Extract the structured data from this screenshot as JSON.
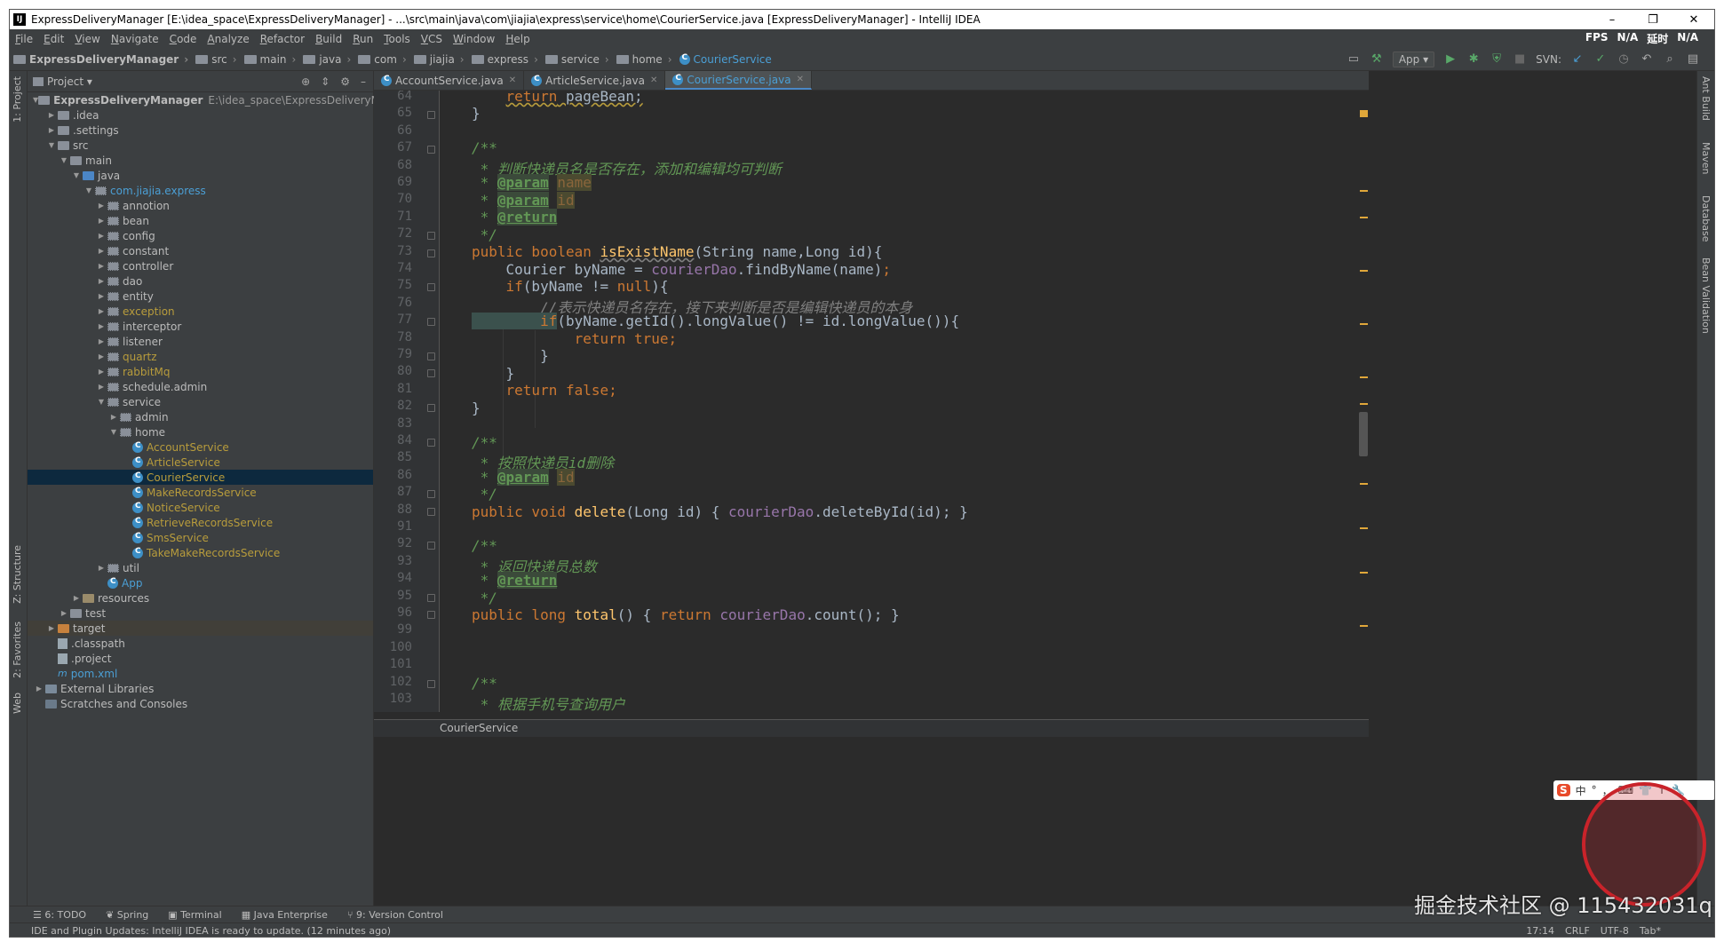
{
  "window": {
    "title": "ExpressDeliveryManager [E:\\idea_space\\ExpressDeliveryManager] - ...\\src\\main\\java\\com\\jiajia\\express\\service\\home\\CourierService.java [ExpressDeliveryManager] - IntelliJ IDEA",
    "app_icon": "IJ"
  },
  "menu": {
    "items": [
      "File",
      "Edit",
      "View",
      "Navigate",
      "Code",
      "Analyze",
      "Refactor",
      "Build",
      "Run",
      "Tools",
      "VCS",
      "Window",
      "Help"
    ],
    "right": [
      "FPS",
      "N/A",
      "延时",
      "N/A"
    ]
  },
  "breadcrumbs": [
    "ExpressDeliveryManager",
    "src",
    "main",
    "java",
    "com",
    "jiajia",
    "express",
    "service",
    "home",
    "CourierService"
  ],
  "toolbar": {
    "run_config": "App",
    "svn_label": "SVN:"
  },
  "left_tabs": {
    "project": "1: Project",
    "structure": "Z: Structure",
    "favorites": "2: Favorites",
    "web": "Web"
  },
  "right_tabs": {
    "ant": "Ant Build",
    "maven": "Maven",
    "database": "Database",
    "bean": "Bean Validation"
  },
  "project_panel": {
    "title": "Project",
    "tree": [
      {
        "label": "ExpressDeliveryManager",
        "extra": "E:\\idea_space\\ExpressDeliveryManager",
        "depth": 0,
        "arrow": "open",
        "icon": "module",
        "bold": true
      },
      {
        "label": ".idea",
        "depth": 1,
        "arrow": "closed",
        "icon": "folder"
      },
      {
        "label": ".settings",
        "depth": 1,
        "arrow": "closed",
        "icon": "folder"
      },
      {
        "label": "src",
        "depth": 1,
        "arrow": "open",
        "icon": "folder"
      },
      {
        "label": "main",
        "depth": 2,
        "arrow": "open",
        "icon": "folder"
      },
      {
        "label": "java",
        "depth": 3,
        "arrow": "open",
        "icon": "folder-blue"
      },
      {
        "label": "com.jiajia.express",
        "depth": 4,
        "arrow": "open",
        "icon": "package",
        "color": "blue"
      },
      {
        "label": "annotion",
        "depth": 5,
        "arrow": "closed",
        "icon": "package"
      },
      {
        "label": "bean",
        "depth": 5,
        "arrow": "closed",
        "icon": "package"
      },
      {
        "label": "config",
        "depth": 5,
        "arrow": "closed",
        "icon": "package"
      },
      {
        "label": "constant",
        "depth": 5,
        "arrow": "closed",
        "icon": "package"
      },
      {
        "label": "controller",
        "depth": 5,
        "arrow": "closed",
        "icon": "package"
      },
      {
        "label": "dao",
        "depth": 5,
        "arrow": "closed",
        "icon": "package"
      },
      {
        "label": "entity",
        "depth": 5,
        "arrow": "closed",
        "icon": "package"
      },
      {
        "label": "exception",
        "depth": 5,
        "arrow": "closed",
        "icon": "package",
        "color": "olive"
      },
      {
        "label": "interceptor",
        "depth": 5,
        "arrow": "closed",
        "icon": "package"
      },
      {
        "label": "listener",
        "depth": 5,
        "arrow": "closed",
        "icon": "package"
      },
      {
        "label": "quartz",
        "depth": 5,
        "arrow": "closed",
        "icon": "package",
        "color": "olive"
      },
      {
        "label": "rabbitMq",
        "depth": 5,
        "arrow": "closed",
        "icon": "package",
        "color": "olive"
      },
      {
        "label": "schedule.admin",
        "depth": 5,
        "arrow": "closed",
        "icon": "package"
      },
      {
        "label": "service",
        "depth": 5,
        "arrow": "open",
        "icon": "package"
      },
      {
        "label": "admin",
        "depth": 6,
        "arrow": "closed",
        "icon": "package"
      },
      {
        "label": "home",
        "depth": 6,
        "arrow": "open",
        "icon": "package"
      },
      {
        "label": "AccountService",
        "depth": 7,
        "icon": "class",
        "color": "olive"
      },
      {
        "label": "ArticleService",
        "depth": 7,
        "icon": "class",
        "color": "olive"
      },
      {
        "label": "CourierService",
        "depth": 7,
        "icon": "class",
        "color": "olive",
        "selected": true
      },
      {
        "label": "MakeRecordsService",
        "depth": 7,
        "icon": "class",
        "color": "olive"
      },
      {
        "label": "NoticeService",
        "depth": 7,
        "icon": "class",
        "color": "olive"
      },
      {
        "label": "RetrieveRecordsService",
        "depth": 7,
        "icon": "class",
        "color": "olive"
      },
      {
        "label": "SmsService",
        "depth": 7,
        "icon": "class",
        "color": "olive"
      },
      {
        "label": "TakeMakeRecordsService",
        "depth": 7,
        "icon": "class",
        "color": "olive"
      },
      {
        "label": "util",
        "depth": 5,
        "arrow": "closed",
        "icon": "package"
      },
      {
        "label": "App",
        "depth": 5,
        "icon": "class",
        "color": "blue"
      },
      {
        "label": "resources",
        "depth": 3,
        "arrow": "closed",
        "icon": "folder-res"
      },
      {
        "label": "test",
        "depth": 2,
        "arrow": "closed",
        "icon": "folder"
      },
      {
        "label": "target",
        "depth": 1,
        "arrow": "closed",
        "icon": "folder-orange",
        "highlight": true
      },
      {
        "label": ".classpath",
        "depth": 1,
        "icon": "file"
      },
      {
        "label": ".project",
        "depth": 1,
        "icon": "file"
      },
      {
        "label": "pom.xml",
        "depth": 1,
        "icon": "maven",
        "color": "blue"
      },
      {
        "label": "External Libraries",
        "depth": 0,
        "arrow": "closed",
        "icon": "libs"
      },
      {
        "label": "Scratches and Consoles",
        "depth": 0,
        "icon": "scratch"
      }
    ]
  },
  "editor": {
    "tabs": [
      {
        "label": "AccountService.java",
        "active": false
      },
      {
        "label": "ArticleService.java",
        "active": false
      },
      {
        "label": "CourierService.java",
        "active": true
      }
    ],
    "line_numbers": [
      "64",
      "65",
      "66",
      "67",
      "68",
      "69",
      "70",
      "71",
      "72",
      "73",
      "74",
      "75",
      "76",
      "77",
      "78",
      "79",
      "80",
      "81",
      "82",
      "83",
      "84",
      "85",
      "86",
      "87",
      "88",
      "91",
      "92",
      "93",
      "94",
      "95",
      "96",
      "99",
      "100",
      "101",
      "102",
      "103"
    ],
    "code_text": {
      "l64_return": "return",
      "l64_rest": " pageBean;",
      "l65": "}",
      "l67": "/**",
      "l68": " * 判断快递员名是否存在，添加和编辑均可判断",
      "l69_star": " * ",
      "l69_tag": "@param",
      "l69_name": "name",
      "l70_star": " * ",
      "l70_tag": "@param",
      "l70_name": "id",
      "l71_star": " * ",
      "l71_tag": "@return",
      "l72": " */",
      "l73_kw": "public boolean ",
      "l73_fn": "isExistName",
      "l73_rest": "(String name,Long id){",
      "l74_a": "    Courier byName = ",
      "l74_fld": "courierDao",
      "l74_b": ".findByName(name)",
      "l74_semi": ";",
      "l75_kw": "    if",
      "l75_rest": "(byName != ",
      "l75_null": "null",
      "l75_end": "){",
      "l76": "        //表示快递员名存在，接下来判断是否是编辑快递员的本身",
      "l77_kw": "        if",
      "l77_rest": "(byName.getId().longValue() != id.longValue()){",
      "l78": "            return true;",
      "l79": "        }",
      "l80": "    }",
      "l81": "    return false;",
      "l82": "}",
      "l84": "/**",
      "l85": " * 按照快递员id删除",
      "l86_star": " * ",
      "l86_tag": "@param",
      "l86_name": "id",
      "l87": " */",
      "l88_kw": "public void ",
      "l88_fn": "delete",
      "l88_a": "(Long id) { ",
      "l88_fld": "courierDao",
      "l88_b": ".deleteById(id)",
      "l88_c": "; }",
      "l92": "/**",
      "l93": " * 返回快递员总数",
      "l94_star": " * ",
      "l94_tag": "@return",
      "l95": " */",
      "l96_kw": "public long ",
      "l96_fn": "total",
      "l96_a": "() { ",
      "l96_ret": "return ",
      "l96_fld": "courierDao",
      "l96_b": ".count()",
      "l96_c": "; }",
      "l102": "/**",
      "l103": " * 根据手机号查询用户"
    },
    "bottom_breadcrumb": "CourierService"
  },
  "bottom_tools": [
    "6: TODO",
    "Spring",
    "Terminal",
    "Java Enterprise",
    "9: Version Control"
  ],
  "status": {
    "message": "IDE and Plugin Updates: IntelliJ IDEA is ready to update. (12 minutes ago)",
    "position": "17:14",
    "line_sep": "CRLF",
    "encoding": "UTF-8",
    "indent": "Tab*"
  },
  "overlay": {
    "watermark": "掘金技术社区 @ 115432031q",
    "ime": [
      "S",
      "中",
      "°",
      "，",
      "⌨",
      "👕",
      "↑",
      "🔧"
    ]
  }
}
